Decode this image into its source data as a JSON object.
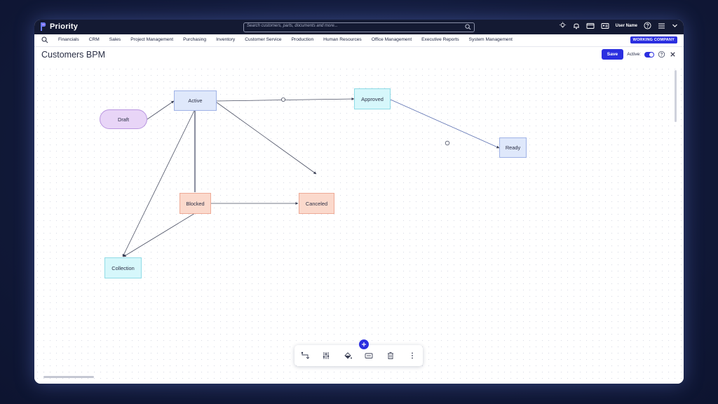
{
  "app": {
    "name": "Priority",
    "user_name": "User Name",
    "company": "WORKING COMPANY"
  },
  "search": {
    "placeholder": "Search customers, parts, documents and more..."
  },
  "menu": {
    "items": [
      "Financials",
      "CRM",
      "Sales",
      "Project Management",
      "Purchasing",
      "Inventory",
      "Customer Service",
      "Production",
      "Human Resources",
      "Office Management",
      "Executive Reports",
      "System Management"
    ]
  },
  "page": {
    "title": "Customers BPM",
    "save_label": "Save",
    "active_label": "Active:",
    "active_on": true
  },
  "diagram": {
    "nodes": {
      "draft": "Draft",
      "active": "Active",
      "approved": "Approved",
      "ready": "Ready",
      "blocked": "Blocked",
      "canceled": "Canceled",
      "collection": "Collection"
    },
    "edges": [
      [
        "Draft",
        "Active"
      ],
      [
        "Active",
        "Approved"
      ],
      [
        "Approved",
        "Ready"
      ],
      [
        "Active",
        "Canceled"
      ],
      [
        "Active",
        "Blocked"
      ],
      [
        "Blocked",
        "Active"
      ],
      [
        "Blocked",
        "Canceled"
      ],
      [
        "Active",
        "Collection"
      ],
      [
        "Blocked",
        "Collection"
      ]
    ]
  },
  "toolbar": {
    "icons": [
      "connector-icon",
      "sliders-icon",
      "paint-bucket-icon",
      "card-icon",
      "trash-icon",
      "more-vertical-icon"
    ]
  },
  "colors": {
    "accent": "#2b2fe0",
    "topbar": "#141a33",
    "node_blue": "#dfe8fb",
    "node_red": "#fbd9cc",
    "node_cyan": "#d6f7fb",
    "node_purple": "#e8d5f7"
  }
}
